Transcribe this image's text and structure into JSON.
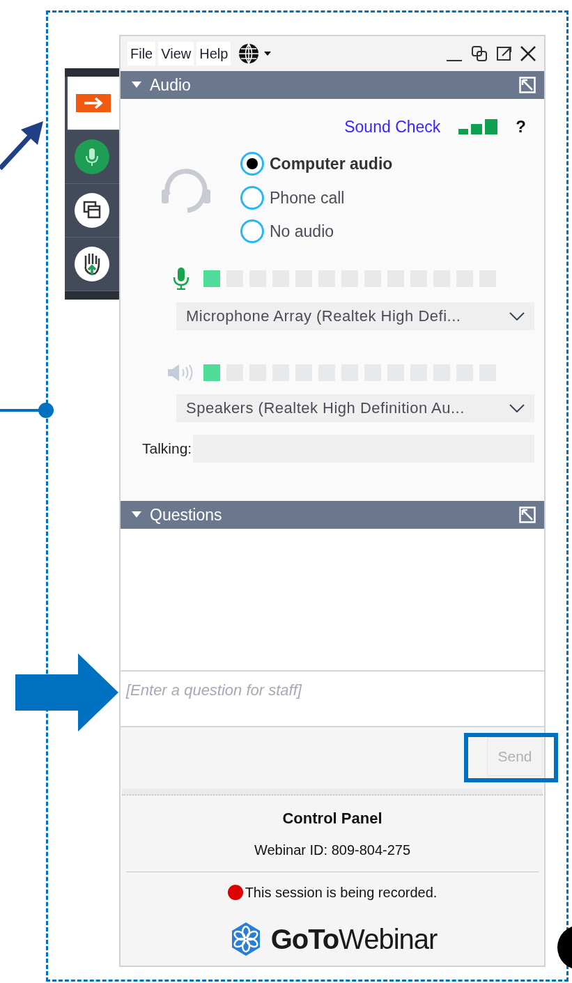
{
  "menu": [
    {
      "label": "File"
    },
    {
      "label": "View"
    },
    {
      "label": "Help"
    }
  ],
  "toolbar": [
    {
      "kind": "arrow",
      "selected": true
    },
    {
      "kind": "mic",
      "selected": false
    },
    {
      "kind": "screens",
      "selected": false
    },
    {
      "kind": "hand",
      "selected": false
    }
  ],
  "audio": {
    "title": "Audio",
    "expanded": true,
    "sound_check": "Sound Check",
    "help": "?",
    "options": [
      {
        "label": "Computer audio",
        "selected": true
      },
      {
        "label": "Phone call",
        "selected": false
      },
      {
        "label": "No audio",
        "selected": false
      }
    ],
    "mic": {
      "level": 0.08,
      "device": "Microphone Array (Realtek High Defi..."
    },
    "speaker": {
      "level": 0.08,
      "device": "Speakers (Realtek High Definition Au..."
    },
    "talking_label": "Talking:"
  },
  "questions": {
    "title": "Questions",
    "expanded": true,
    "placeholder": "[Enter a question for staff]",
    "send": "Send",
    "send_disabled": true
  },
  "footer": {
    "title": "Control Panel",
    "webinar_id": "Webinar ID: 809-804-275",
    "recording": "This session is being recorded.",
    "logo_bold": "GoTo",
    "logo_light": "Webinar"
  }
}
